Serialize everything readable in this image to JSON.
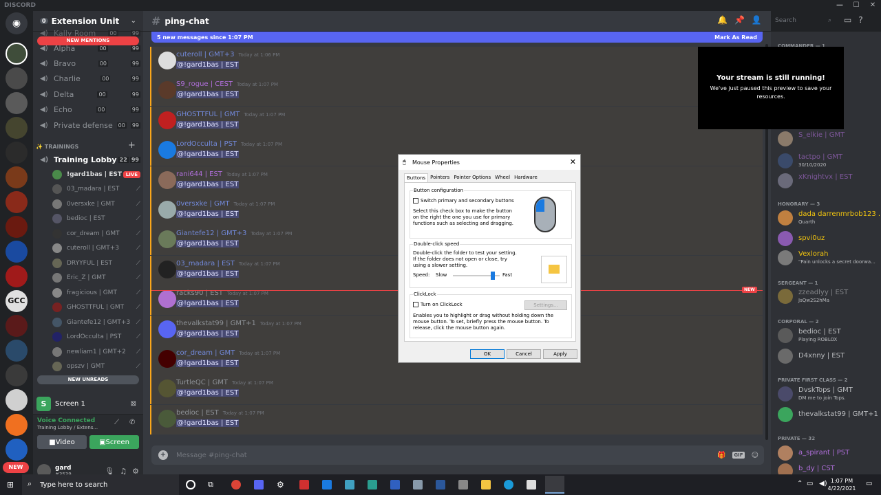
{
  "app": {
    "title": "DISCORD"
  },
  "server": {
    "name": "Extension Unit",
    "badge": "0"
  },
  "pills": {
    "new_mentions": "NEW MENTIONS",
    "new_unreads": "NEW UNREADS"
  },
  "channels": [
    {
      "name": "Kally Room",
      "a": "00",
      "b": "99"
    },
    {
      "name": "Alpha",
      "a": "00",
      "b": "99"
    },
    {
      "name": "Bravo",
      "a": "00",
      "b": "99"
    },
    {
      "name": "Charlie",
      "a": "00",
      "b": "99"
    },
    {
      "name": "Delta",
      "a": "00",
      "b": "99"
    },
    {
      "name": "Echo",
      "a": "00",
      "b": "99"
    },
    {
      "name": "Private defense",
      "a": "00",
      "b": "99"
    }
  ],
  "category": {
    "name": "✨ TRAININGS"
  },
  "training": {
    "name": "Training Lobby",
    "a": "22",
    "b": "99"
  },
  "voice_users": [
    {
      "name": "!gard1bas | EST",
      "live": "LIVE",
      "color": "#dcddde"
    },
    {
      "name": "03_madara | EST"
    },
    {
      "name": "0versxke | GMT"
    },
    {
      "name": "bedioc | EST"
    },
    {
      "name": "cor_dream | GMT"
    },
    {
      "name": "cuteroll | GMT+3"
    },
    {
      "name": "DRYYFUL | EST"
    },
    {
      "name": "Eric_Z | GMT"
    },
    {
      "name": "fragicious | GMT"
    },
    {
      "name": "GHOSTTFUL | GMT"
    },
    {
      "name": "Giantefe12 | GMT+3"
    },
    {
      "name": "LordOcculta | PST"
    },
    {
      "name": "newliam1 | GMT+2"
    },
    {
      "name": "opszv | GMT"
    }
  ],
  "screen": {
    "label": "Screen 1",
    "letter": "S"
  },
  "voice": {
    "status": "Voice Connected",
    "location": "Training Lobby / Extens...",
    "video": "Video",
    "screen": "Screen"
  },
  "user": {
    "name": "gard",
    "tag": "#3539",
    "new": "NEW"
  },
  "channel_header": {
    "name": "ping-chat",
    "search": "Search"
  },
  "new_messages": {
    "text": "5 new messages since 1:07 PM",
    "action": "Mark As Read"
  },
  "messages": [
    {
      "author": "cuteroll | GMT+3",
      "color": "#7289da",
      "time": "Today at 1:06 PM",
      "text": "@!gard1bas | EST"
    },
    {
      "author": "S9_rogue | CEST",
      "color": "#b06fdb",
      "time": "Today at 1:07 PM",
      "text": "@!gard1bas | EST"
    },
    {
      "author": "GHOSTTFUL | GMT",
      "color": "#7289da",
      "time": "Today at 1:07 PM",
      "text": "@!gard1bas | EST"
    },
    {
      "author": "LordOcculta | PST",
      "color": "#7289da",
      "time": "Today at 1:07 PM",
      "text": "@!gard1bas | EST"
    },
    {
      "author": "rani644 | EST",
      "color": "#b06fdb",
      "time": "Today at 1:07 PM",
      "text": "@!gard1bas | EST"
    },
    {
      "author": "0versxke | GMT",
      "color": "#7289da",
      "time": "Today at 1:07 PM",
      "text": "@!gard1bas | EST"
    },
    {
      "author": "Giantefe12 | GMT+3",
      "color": "#7289da",
      "time": "Today at 1:07 PM",
      "text": "@!gard1bas | EST"
    },
    {
      "author": "03_madara | EST",
      "color": "#7289da",
      "time": "Today at 1:07 PM",
      "text": "@!gard1bas | EST"
    },
    {
      "author": "racks90 | EST",
      "color": "#8e9297",
      "time": "Today at 1:07 PM",
      "text": "@!gard1bas | EST"
    },
    {
      "author": "thevalkstat99 | GMT+1",
      "color": "#8e9297",
      "time": "Today at 1:07 PM",
      "text": "@!gard1bas | EST"
    },
    {
      "author": "cor_dream | GMT",
      "color": "#7289da",
      "time": "Today at 1:07 PM",
      "text": "@!gard1bas | EST"
    },
    {
      "author": "TurtleQC | GMT",
      "color": "#8e9297",
      "time": "Today at 1:07 PM",
      "text": "@!gard1bas | EST"
    },
    {
      "author": "bedioc | EST",
      "color": "#8e9297",
      "time": "Today at 1:07 PM",
      "text": "@!gard1bas | EST"
    }
  ],
  "new_tag": "NEW",
  "composer": {
    "placeholder": "Message #ping-chat",
    "gif": "GIF"
  },
  "stream_popup": {
    "title": "Your stream is still running!",
    "body": "We've just paused this preview to save your resources."
  },
  "members": {
    "commander": "COMMANDER — 1",
    "m1": {
      "name": "S_elkie | GMT"
    },
    "m2": {
      "name": "tactpo | GMT",
      "status": "30/10/2020"
    },
    "m3": {
      "name": "xKnightvx | EST"
    },
    "honorary": "HONORARY — 3",
    "m4": {
      "name": "dada darrenmrbob123 ...",
      "status": "Quarth"
    },
    "m5": {
      "name": "spvi0uz"
    },
    "m6": {
      "name": "Vexlorah",
      "status": "\"Pain unlocks a secret doorwa..."
    },
    "sergeant": "SERGEANT — 1",
    "m7": {
      "name": "zzeadlyy | EST",
      "status": "JsQw2S2hMa"
    },
    "corporal": "CORPORAL — 2",
    "m8": {
      "name": "bedioc | EST",
      "status": "Playing ROBLOX"
    },
    "m9": {
      "name": "D4xnny | EST"
    },
    "pfc": "PRIVATE FIRST CLASS — 2",
    "m10": {
      "name": "DvskTops | GMT",
      "status": "DM me to join Tops."
    },
    "m11": {
      "name": "thevalkstat99 | GMT+1"
    },
    "private": "PRIVATE — 32",
    "m12": {
      "name": "a_spirant | PST"
    },
    "m13": {
      "name": "b_dy | CST"
    }
  },
  "dialog": {
    "title": "Mouse Properties",
    "tabs": [
      "Buttons",
      "Pointers",
      "Pointer Options",
      "Wheel",
      "Hardware"
    ],
    "button_config": "Button configuration",
    "switch": "Switch primary and secondary buttons",
    "switch_desc": "Select this check box to make the button on the right the one you use for primary functions such as selecting and dragging.",
    "dblclick": "Double-click speed",
    "dblclick_desc": "Double-click the folder to test your setting. If the folder does not open or close, try using a slower setting.",
    "speed": "Speed:",
    "slow": "Slow",
    "fast": "Fast",
    "speed_level": 0.85,
    "clicklock": "ClickLock",
    "clicklock_on": "Turn on ClickLock",
    "settings": "Settings...",
    "clicklock_desc": "Enables you to highlight or drag without holding down the mouse button. To set, briefly press the mouse button. To release, click the mouse button again.",
    "ok": "OK",
    "cancel": "Cancel",
    "apply": "Apply"
  },
  "taskbar": {
    "search": "Type here to search",
    "time": "1:07 PM",
    "date": "4/22/2021"
  }
}
